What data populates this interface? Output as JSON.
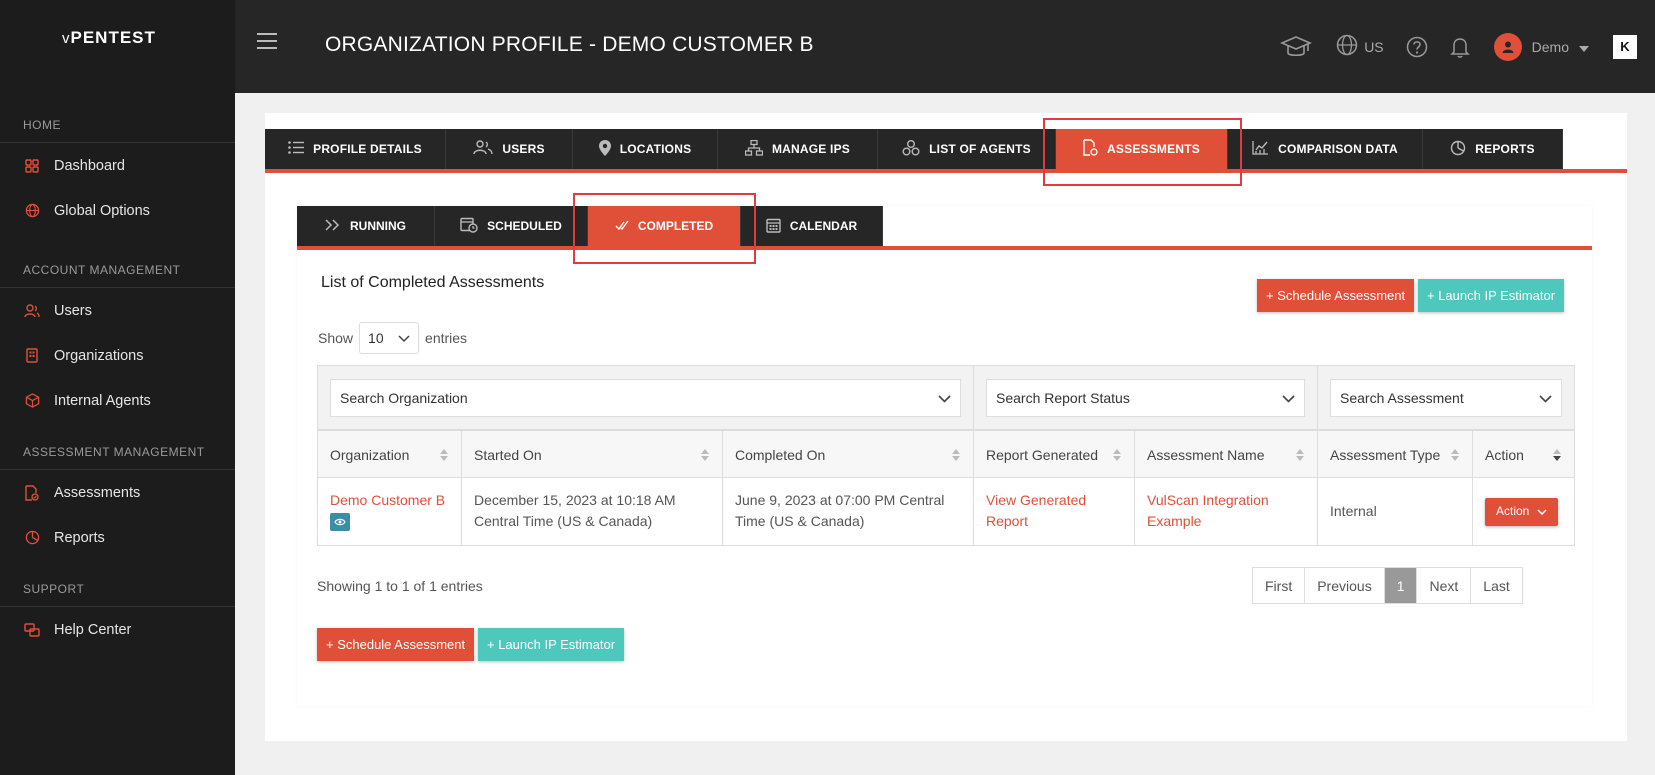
{
  "app": {
    "logo_prefix": "v",
    "logo_main": "PENTEST",
    "page_title": "ORGANIZATION PROFILE - DEMO CUSTOMER B"
  },
  "header": {
    "language": "US",
    "user_name": "Demo",
    "brand_badge": "K"
  },
  "sidebar": {
    "sections": [
      {
        "heading": "HOME",
        "items": [
          {
            "label": "Dashboard",
            "icon": "dashboard-icon"
          },
          {
            "label": "Global Options",
            "icon": "globe-icon"
          }
        ]
      },
      {
        "heading": "ACCOUNT MANAGEMENT",
        "items": [
          {
            "label": "Users",
            "icon": "users-icon"
          },
          {
            "label": "Organizations",
            "icon": "building-icon"
          },
          {
            "label": "Internal Agents",
            "icon": "cube-icon"
          }
        ]
      },
      {
        "heading": "ASSESSMENT MANAGEMENT",
        "items": [
          {
            "label": "Assessments",
            "icon": "assessment-file-icon"
          },
          {
            "label": "Reports",
            "icon": "reports-chart-icon"
          }
        ]
      },
      {
        "heading": "SUPPORT",
        "items": [
          {
            "label": "Help Center",
            "icon": "help-center-icon"
          }
        ]
      }
    ]
  },
  "tabs": [
    {
      "label": "PROFILE DETAILS",
      "icon": "list-icon"
    },
    {
      "label": "USERS",
      "icon": "users-icon"
    },
    {
      "label": "LOCATIONS",
      "icon": "map-pin-icon"
    },
    {
      "label": "MANAGE IPS",
      "icon": "network-icon"
    },
    {
      "label": "LIST OF AGENTS",
      "icon": "agents-icon"
    },
    {
      "label": "ASSESSMENTS",
      "icon": "assessment-file-icon",
      "active": true
    },
    {
      "label": "COMPARISON DATA",
      "icon": "chart-line-icon"
    },
    {
      "label": "REPORTS",
      "icon": "reports-chart-icon"
    }
  ],
  "subtabs": [
    {
      "label": "RUNNING",
      "icon": "double-chevron-icon"
    },
    {
      "label": "SCHEDULED",
      "icon": "calendar-clock-icon"
    },
    {
      "label": "COMPLETED",
      "icon": "double-check-icon",
      "active": true
    },
    {
      "label": "CALENDAR",
      "icon": "calendar-icon"
    }
  ],
  "list": {
    "title": "List of Completed Assessments",
    "schedule_button": "+ Schedule Assessment",
    "estimator_button": "+ Launch IP Estimator",
    "show_label": "Show",
    "entries_value": "10",
    "entries_label": "entries",
    "filters": {
      "organization": "Search Organization",
      "report_status": "Search Report Status",
      "assessment": "Search Assessment"
    },
    "columns": [
      "Organization",
      "Started On",
      "Completed On",
      "Report Generated",
      "Assessment Name",
      "Assessment Type",
      "Action"
    ],
    "rows": [
      {
        "organization": "Demo Customer B",
        "started_on": "December 15, 2023 at 10:18 AM Central Time (US & Canada)",
        "completed_on": "June 9, 2023 at 07:00 PM Central Time (US & Canada)",
        "report": "View Generated Report",
        "assessment_name": "VulScan Integration Example",
        "assessment_type": "Internal",
        "action": "Action"
      }
    ],
    "showing": "Showing 1 to 1 of 1 entries",
    "pagination": {
      "first": "First",
      "previous": "Previous",
      "current": "1",
      "next": "Next",
      "last": "Last"
    }
  },
  "colors": {
    "accent": "#e05038",
    "teal": "#4ec8bd",
    "dark": "#262626",
    "highlight": "#e03c40"
  }
}
